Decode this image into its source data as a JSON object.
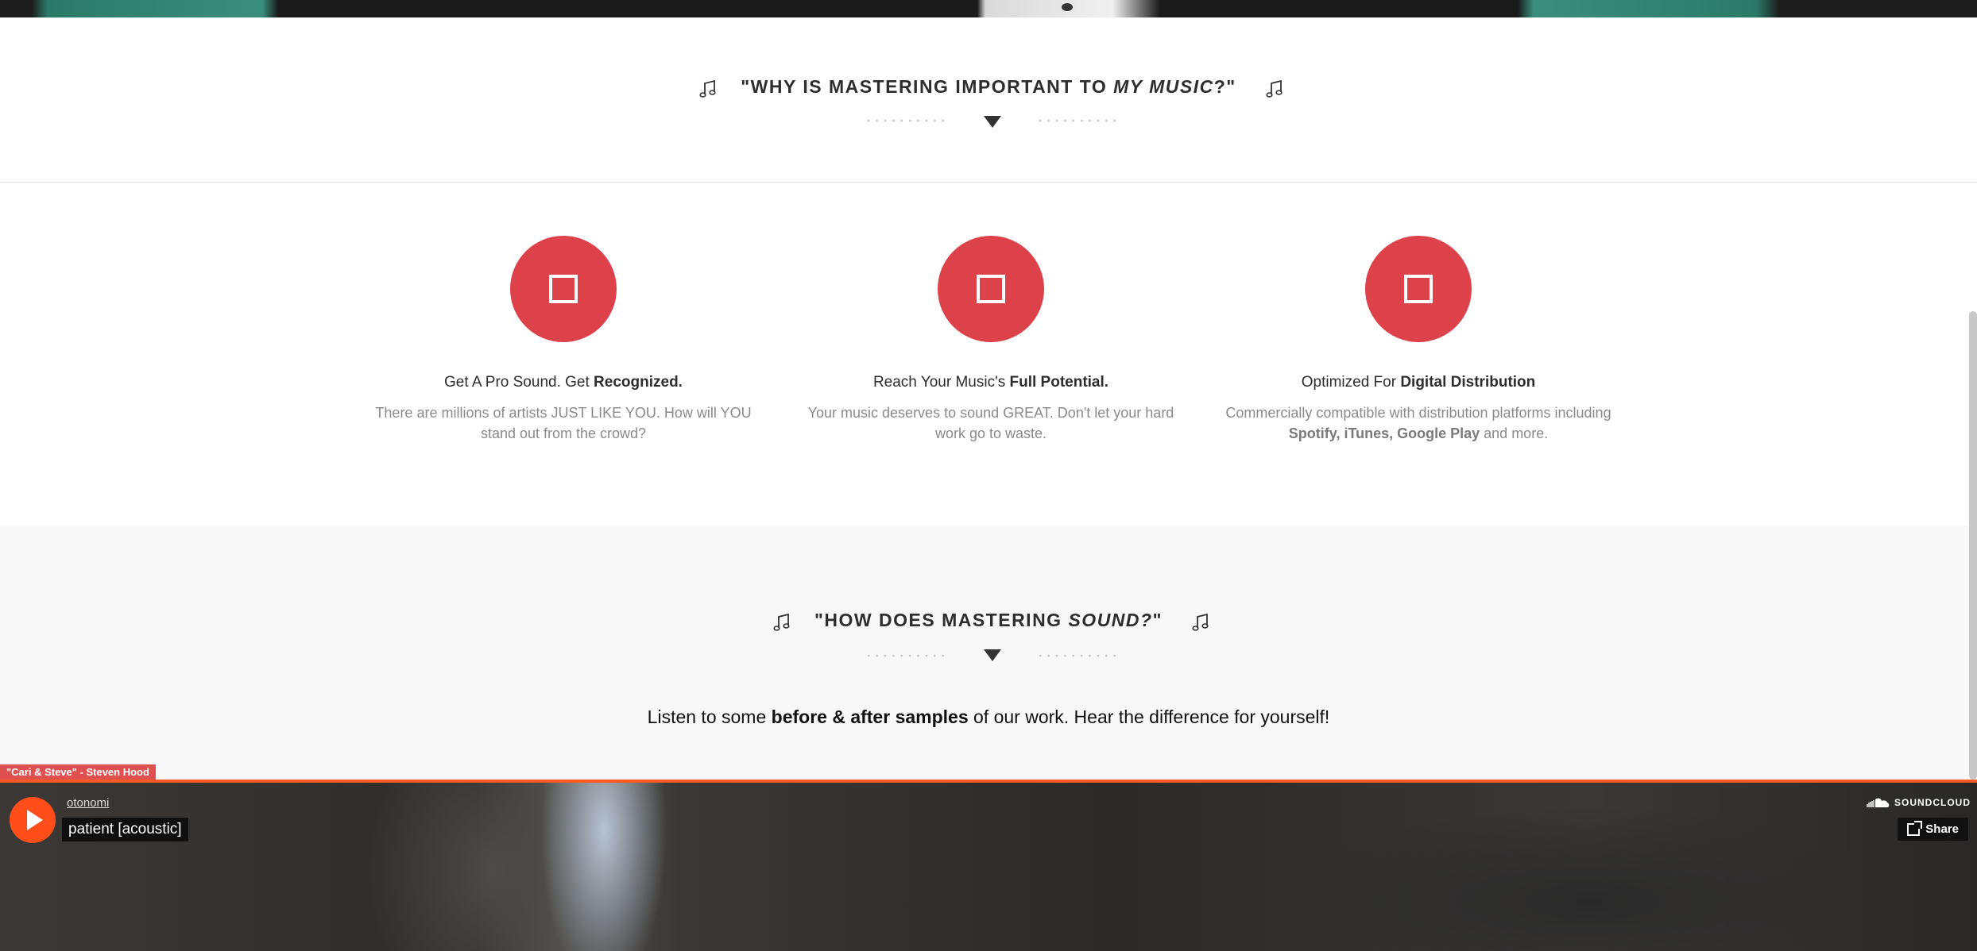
{
  "section_why": {
    "heading_prefix": "\"WHY IS MASTERING IMPORTANT TO ",
    "heading_emph": "MY MUSIC",
    "heading_suffix": "?\""
  },
  "features": [
    {
      "title_plain": "Get A Pro Sound. Get ",
      "title_bold": "Recognized.",
      "desc_plain": "There are millions of artists JUST LIKE YOU. How will YOU stand out from the crowd?"
    },
    {
      "title_plain": "Reach Your Music's ",
      "title_bold": "Full Potential.",
      "desc_plain": "Your music deserves to sound GREAT. Don't let your hard work go to waste."
    },
    {
      "title_plain": "Optimized For ",
      "title_bold": "Digital Distribution",
      "desc_prefix": "Commercially compatible with distribution platforms including ",
      "desc_bold": "Spotify, iTunes, Google Play",
      "desc_suffix": " and more."
    }
  ],
  "section_how": {
    "heading_prefix": "\"HOW DOES MASTERING ",
    "heading_emph": "SOUND?",
    "heading_suffix": "\"",
    "listen_prefix": "Listen to some ",
    "listen_bold": "before & after samples",
    "listen_suffix": " of our work. Hear the difference for yourself!"
  },
  "sample_label": "\"Cari & Steve\" - Steven Hood",
  "player": {
    "artist": "otonomi",
    "track": "patient [acoustic]",
    "brand": "SOUNDCLOUD",
    "share_label": "Share"
  },
  "colors": {
    "accent_red": "#dd4149",
    "soundcloud_orange": "#ff5a1f"
  },
  "icons": [
    "music-note-icon",
    "chevron-down-icon",
    "square-icon",
    "play-icon",
    "soundcloud-icon",
    "share-icon"
  ]
}
